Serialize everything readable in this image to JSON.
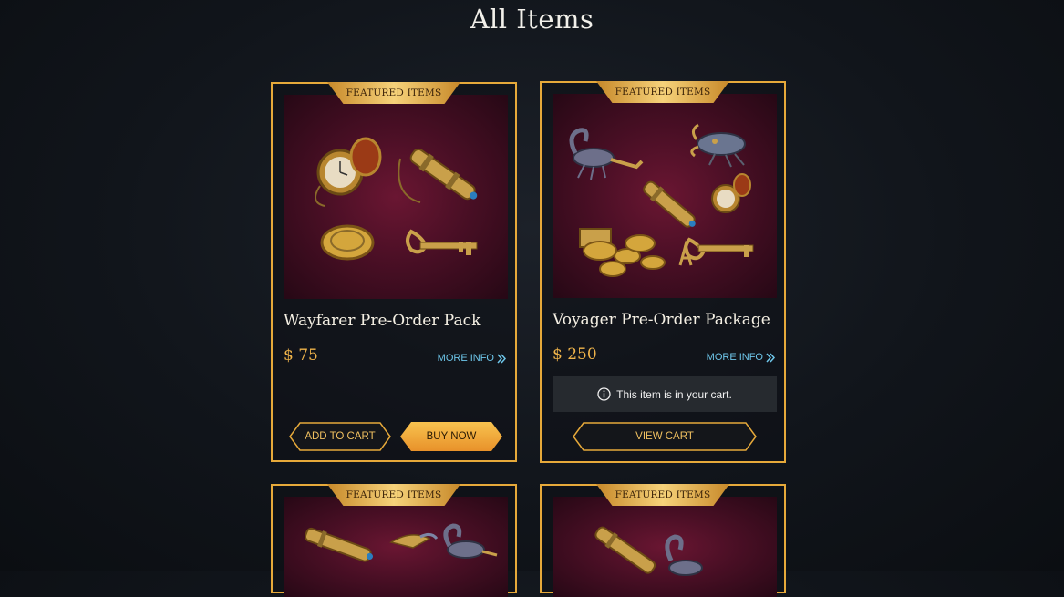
{
  "page": {
    "title": "All Items"
  },
  "ribbon_label": "FEATURED ITEMS",
  "products": [
    {
      "name": "Wayfarer Pre-Order Pack",
      "price": "$ 75",
      "more_info": "MORE INFO",
      "add_to_cart": "ADD TO CART",
      "buy_now": "BUY NOW"
    },
    {
      "name": "Voyager Pre-Order Package",
      "price": "$ 250",
      "more_info": "MORE INFO",
      "cart_note": "This item is in your cart.",
      "view_cart": "VIEW CART"
    }
  ],
  "colors": {
    "accent_gold": "#e6a93a",
    "price": "#f0b44a",
    "link": "#6ec6ea",
    "art_bg": "#4a0f25"
  },
  "icons": [
    "info-icon",
    "double-chevron-right-icon"
  ]
}
